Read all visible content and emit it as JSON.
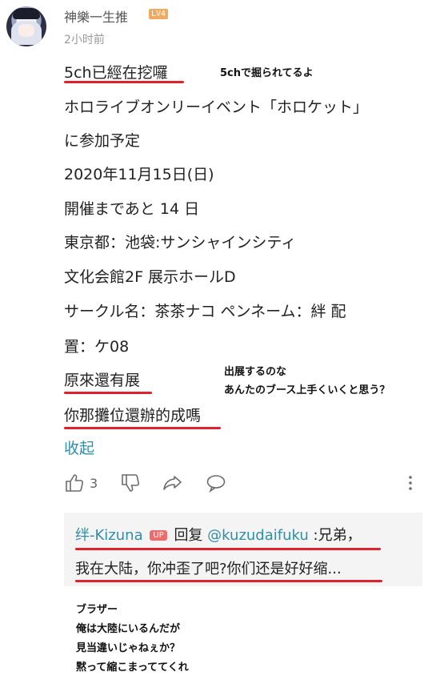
{
  "comment": {
    "username": "神樂一生推",
    "level": "LV4",
    "time": "2小时前",
    "lines": [
      "5ch已經在挖囉",
      "ホロライブオンリーイベント「ホロケット」",
      "に参加予定",
      "2020年11月15日(日)",
      "開催まであと 14 日",
      "東京都：池袋:サンシャインシティ",
      "文化会館2F 展示ホールD",
      "サークル名：茶茶ナコ ペンネーム：絆 配",
      "置：ケ08",
      "原來還有展",
      "你那攤位還辦的成嗎"
    ],
    "fold_label": "收起",
    "like_count": "3"
  },
  "annotations": {
    "note1": "5chで掘られてるよ",
    "note2_line1": "出展するのな",
    "note2_line2": "あんたのブース上手くいくと思う？",
    "bottom": [
      "ブラザー",
      "俺は大陸にいるんだが",
      "見当違いじゃねぇか？",
      "黙って縮こまっててくれ"
    ]
  },
  "reply": {
    "author": "绊-Kizuna",
    "badge": "UP",
    "reply_word": "回复",
    "mention": "@kuzudaifuku",
    "text1": ":兄弟，",
    "text2": "我在大陆，你冲歪了吧?你们还是好好缩..."
  },
  "icons": [
    "like-icon",
    "dislike-icon",
    "share-icon",
    "comment-icon",
    "more-icon"
  ]
}
